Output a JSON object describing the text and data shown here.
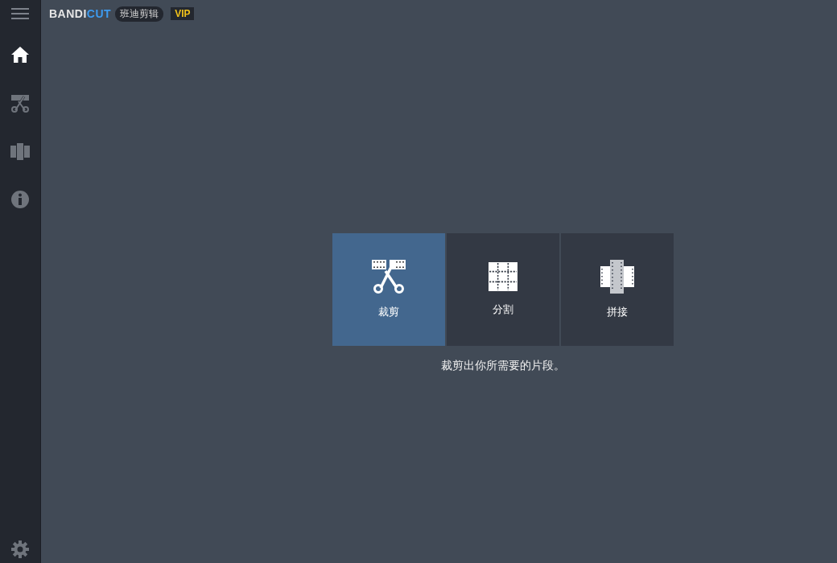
{
  "header": {
    "logo_main": "BANDI",
    "logo_accent": "CUT",
    "product_badge": "班迪剪辑",
    "vip_badge": "VIP"
  },
  "sidebar": {
    "items": [
      {
        "kind": "home",
        "selected": true
      },
      {
        "kind": "cut",
        "selected": false
      },
      {
        "kind": "join",
        "selected": false
      },
      {
        "kind": "info",
        "selected": false
      }
    ]
  },
  "modes": [
    {
      "kind": "cut",
      "label": "裁剪",
      "selected": true
    },
    {
      "kind": "split",
      "label": "分割",
      "selected": false
    },
    {
      "kind": "join",
      "label": "拼接",
      "selected": false
    }
  ],
  "description": "裁剪出你所需要的片段。"
}
